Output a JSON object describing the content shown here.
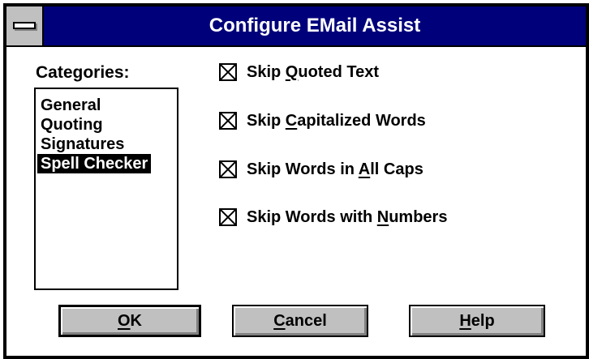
{
  "window": {
    "title": "Configure EMail Assist",
    "titlebar_color": "#00007a"
  },
  "categories": {
    "label": "Categories:",
    "items": [
      "General",
      "Quoting",
      "Signatures",
      "Spell Checker"
    ],
    "selected": "Spell Checker"
  },
  "options": [
    {
      "pre": "Skip ",
      "mnemonic": "Q",
      "post": "uoted Text",
      "checked": true
    },
    {
      "pre": "Skip ",
      "mnemonic": "C",
      "post": "apitalized Words",
      "checked": true
    },
    {
      "pre": "Skip Words in ",
      "mnemonic": "A",
      "post": "ll Caps",
      "checked": true
    },
    {
      "pre": "Skip Words with ",
      "mnemonic": "N",
      "post": "umbers",
      "checked": true
    }
  ],
  "buttons": {
    "ok": {
      "mnemonic": "O",
      "rest": "K"
    },
    "cancel": {
      "mnemonic": "C",
      "rest": "ancel"
    },
    "help": {
      "mnemonic": "H",
      "rest": "elp"
    }
  }
}
